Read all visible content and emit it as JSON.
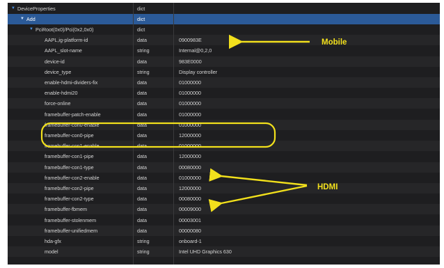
{
  "tree": {
    "rows": [
      {
        "key": "DeviceProperties",
        "type": "dict",
        "value": "",
        "indent": 0,
        "expander": "▼"
      },
      {
        "key": "Add",
        "type": "dict",
        "value": "",
        "indent": 1,
        "expander": "▼"
      },
      {
        "key": "PciRoot(0x0)/Pci(0x2,0x0)",
        "type": "dict",
        "value": "",
        "indent": 2,
        "expander": "▼"
      },
      {
        "key": "AAPL,ig-platform-id",
        "type": "data",
        "value": "0900983E",
        "indent": 3,
        "expander": ""
      },
      {
        "key": "AAPL_slot-name",
        "type": "string",
        "value": "Internal@0,2,0",
        "indent": 3,
        "expander": ""
      },
      {
        "key": "device-id",
        "type": "data",
        "value": "983E0000",
        "indent": 3,
        "expander": ""
      },
      {
        "key": "device_type",
        "type": "string",
        "value": "Display controller",
        "indent": 3,
        "expander": ""
      },
      {
        "key": "enable-hdmi-dividers-fix",
        "type": "data",
        "value": "01000000",
        "indent": 3,
        "expander": ""
      },
      {
        "key": "enable-hdmi20",
        "type": "data",
        "value": "01000000",
        "indent": 3,
        "expander": ""
      },
      {
        "key": "force-online",
        "type": "data",
        "value": "01000000",
        "indent": 3,
        "expander": ""
      },
      {
        "key": "framebuffer-patch-enable",
        "type": "data",
        "value": "01000000",
        "indent": 3,
        "expander": ""
      },
      {
        "key": "framebuffer-con0-enable",
        "type": "data",
        "value": "01000000",
        "indent": 3,
        "expander": ""
      },
      {
        "key": "framebuffer-con0-pipe",
        "type": "data",
        "value": "12000000",
        "indent": 3,
        "expander": ""
      },
      {
        "key": "framebuffer-con1-enable",
        "type": "data",
        "value": "01000000",
        "indent": 3,
        "expander": ""
      },
      {
        "key": "framebuffer-con1-pipe",
        "type": "data",
        "value": "12000000",
        "indent": 3,
        "expander": ""
      },
      {
        "key": "framebuffer-con1-type",
        "type": "data",
        "value": "00080000",
        "indent": 3,
        "expander": ""
      },
      {
        "key": "framebuffer-con2-enable",
        "type": "data",
        "value": "01000000",
        "indent": 3,
        "expander": ""
      },
      {
        "key": "framebuffer-con2-pipe",
        "type": "data",
        "value": "12000000",
        "indent": 3,
        "expander": ""
      },
      {
        "key": "framebuffer-con2-type",
        "type": "data",
        "value": "00080000",
        "indent": 3,
        "expander": ""
      },
      {
        "key": "framebuffer-fbmem",
        "type": "data",
        "value": "00009000",
        "indent": 3,
        "expander": ""
      },
      {
        "key": "framebuffer-stolenmem",
        "type": "data",
        "value": "00003001",
        "indent": 3,
        "expander": ""
      },
      {
        "key": "framebuffer-unifiedmem",
        "type": "data",
        "value": "00000080",
        "indent": 3,
        "expander": ""
      },
      {
        "key": "hda-gfx",
        "type": "string",
        "value": "onboard-1",
        "indent": 3,
        "expander": ""
      },
      {
        "key": "model",
        "type": "string",
        "value": "Intel UHD Graphics 630",
        "indent": 3,
        "expander": ""
      }
    ]
  },
  "annotations": {
    "mobile_label": "Mobile",
    "hdmi_label": "HDMI",
    "color": "#f2e01c"
  },
  "colors": {
    "background": "#1e1e20",
    "alt_row": "#262628",
    "selected_row": "#2b5a98",
    "text": "#d6d6d6"
  }
}
